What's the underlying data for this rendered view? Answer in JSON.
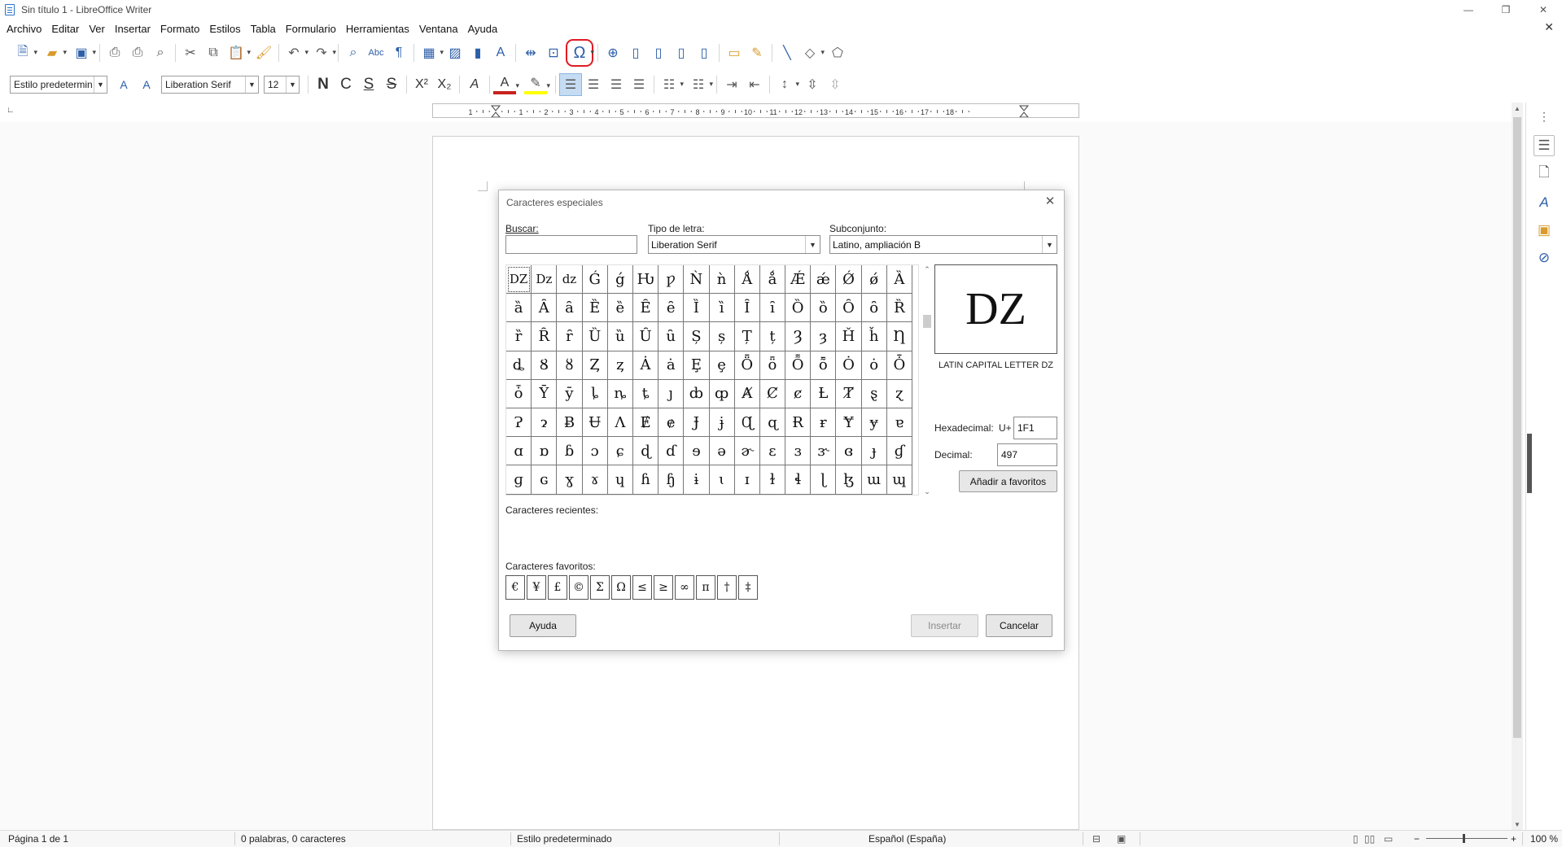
{
  "window": {
    "title": "Sin título 1 - LibreOffice Writer",
    "minimize_icon": "minimize-icon",
    "restore_icon": "restore-icon",
    "close_icon": "close-icon"
  },
  "menubar": {
    "items": [
      "Archivo",
      "Editar",
      "Ver",
      "Insertar",
      "Formato",
      "Estilos",
      "Tabla",
      "Formulario",
      "Herramientas",
      "Ventana",
      "Ayuda"
    ]
  },
  "formatting": {
    "paragraph_style": "Estilo predetermin",
    "font_name": "Liberation Serif",
    "font_size": "12",
    "bold": "N",
    "italic": "C",
    "underline": "S",
    "strike": "S"
  },
  "ruler": {
    "numbers": [
      "1",
      "1",
      "2",
      "3",
      "4",
      "5",
      "6",
      "7",
      "8",
      "9",
      "10",
      "11",
      "12",
      "13",
      "14",
      "15",
      "16",
      "17",
      "18"
    ]
  },
  "statusbar": {
    "page": "Página 1 de 1",
    "words": "0 palabras, 0 caracteres",
    "style": "Estilo predeterminado",
    "language": "Español (España)",
    "zoom": "100 %"
  },
  "dialog": {
    "title": "Caracteres especiales",
    "search_label": "Buscar:",
    "search_value": "",
    "font_label": "Tipo de letra:",
    "font_value": "Liberation Serif",
    "subset_label": "Subconjunto:",
    "subset_value": "Latino, ampliación B",
    "characters": [
      "DZ",
      "Dz",
      "dz",
      "Ǵ",
      "ǵ",
      "Ƕ",
      "ƿ",
      "Ǹ",
      "ǹ",
      "Ǻ",
      "ǻ",
      "Ǽ",
      "ǽ",
      "Ǿ",
      "ǿ",
      "Ȁ",
      "ȁ",
      "Ȃ",
      "ȃ",
      "Ȅ",
      "ȅ",
      "Ȇ",
      "ȇ",
      "Ȉ",
      "ȉ",
      "Ȋ",
      "ȋ",
      "Ȍ",
      "ȍ",
      "Ȏ",
      "ȏ",
      "Ȑ",
      "ȑ",
      "Ȓ",
      "ȓ",
      "Ȕ",
      "ȕ",
      "Ȗ",
      "ȗ",
      "Ș",
      "ș",
      "Ț",
      "ț",
      "Ȝ",
      "ȝ",
      "Ȟ",
      "ȟ",
      "Ƞ",
      "ȡ",
      "Ȣ",
      "ȣ",
      "Ȥ",
      "ȥ",
      "Ȧ",
      "ȧ",
      "Ȩ",
      "ȩ",
      "Ȫ",
      "ȫ",
      "Ȭ",
      "ȭ",
      "Ȯ",
      "ȯ",
      "Ȱ",
      "ȱ",
      "Ȳ",
      "ȳ",
      "ȴ",
      "ȵ",
      "ȶ",
      "ȷ",
      "ȸ",
      "ȹ",
      "Ⱥ",
      "Ȼ",
      "ȼ",
      "Ƚ",
      "Ⱦ",
      "ȿ",
      "ɀ",
      "Ɂ",
      "ɂ",
      "Ƀ",
      "Ʉ",
      "Ʌ",
      "Ɇ",
      "ɇ",
      "Ɉ",
      "ɉ",
      "Ɋ",
      "ɋ",
      "Ɍ",
      "ɍ",
      "Ɏ",
      "ɏ",
      "ɐ",
      "ɑ",
      "ɒ",
      "ɓ",
      "ɔ",
      "ɕ",
      "ɖ",
      "ɗ",
      "ɘ",
      "ə",
      "ɚ",
      "ɛ",
      "ɜ",
      "ɝ",
      "ɞ",
      "ɟ",
      "ɠ",
      "ɡ",
      "ɢ",
      "ɣ",
      "ɤ",
      "ɥ",
      "ɦ",
      "ɧ",
      "ɨ",
      "ɩ",
      "ɪ",
      "ɫ",
      "ɬ",
      "ɭ",
      "ɮ",
      "ɯ",
      "ɰ"
    ],
    "selected_char": "DZ",
    "selected_name": "LATIN CAPITAL LETTER DZ",
    "hex_label": "Hexadecimal:",
    "hex_prefix": "U+",
    "hex_value": "1F1",
    "dec_label": "Decimal:",
    "dec_value": "497",
    "add_fav_label": "Añadir a favoritos",
    "recent_label": "Caracteres recientes:",
    "favorites_label": "Caracteres favoritos:",
    "favorites": [
      "€",
      "¥",
      "£",
      "©",
      "Σ",
      "Ω",
      "≤",
      "≥",
      "∞",
      "π",
      "†",
      "‡"
    ],
    "help_label": "Ayuda",
    "insert_label": "Insertar",
    "cancel_label": "Cancelar"
  },
  "colors": {
    "accent": "#2d5ea8",
    "highlight_ring": "#e01b24",
    "font_color_bar": "#c9211e",
    "highlight_color_bar": "#ffff00"
  }
}
